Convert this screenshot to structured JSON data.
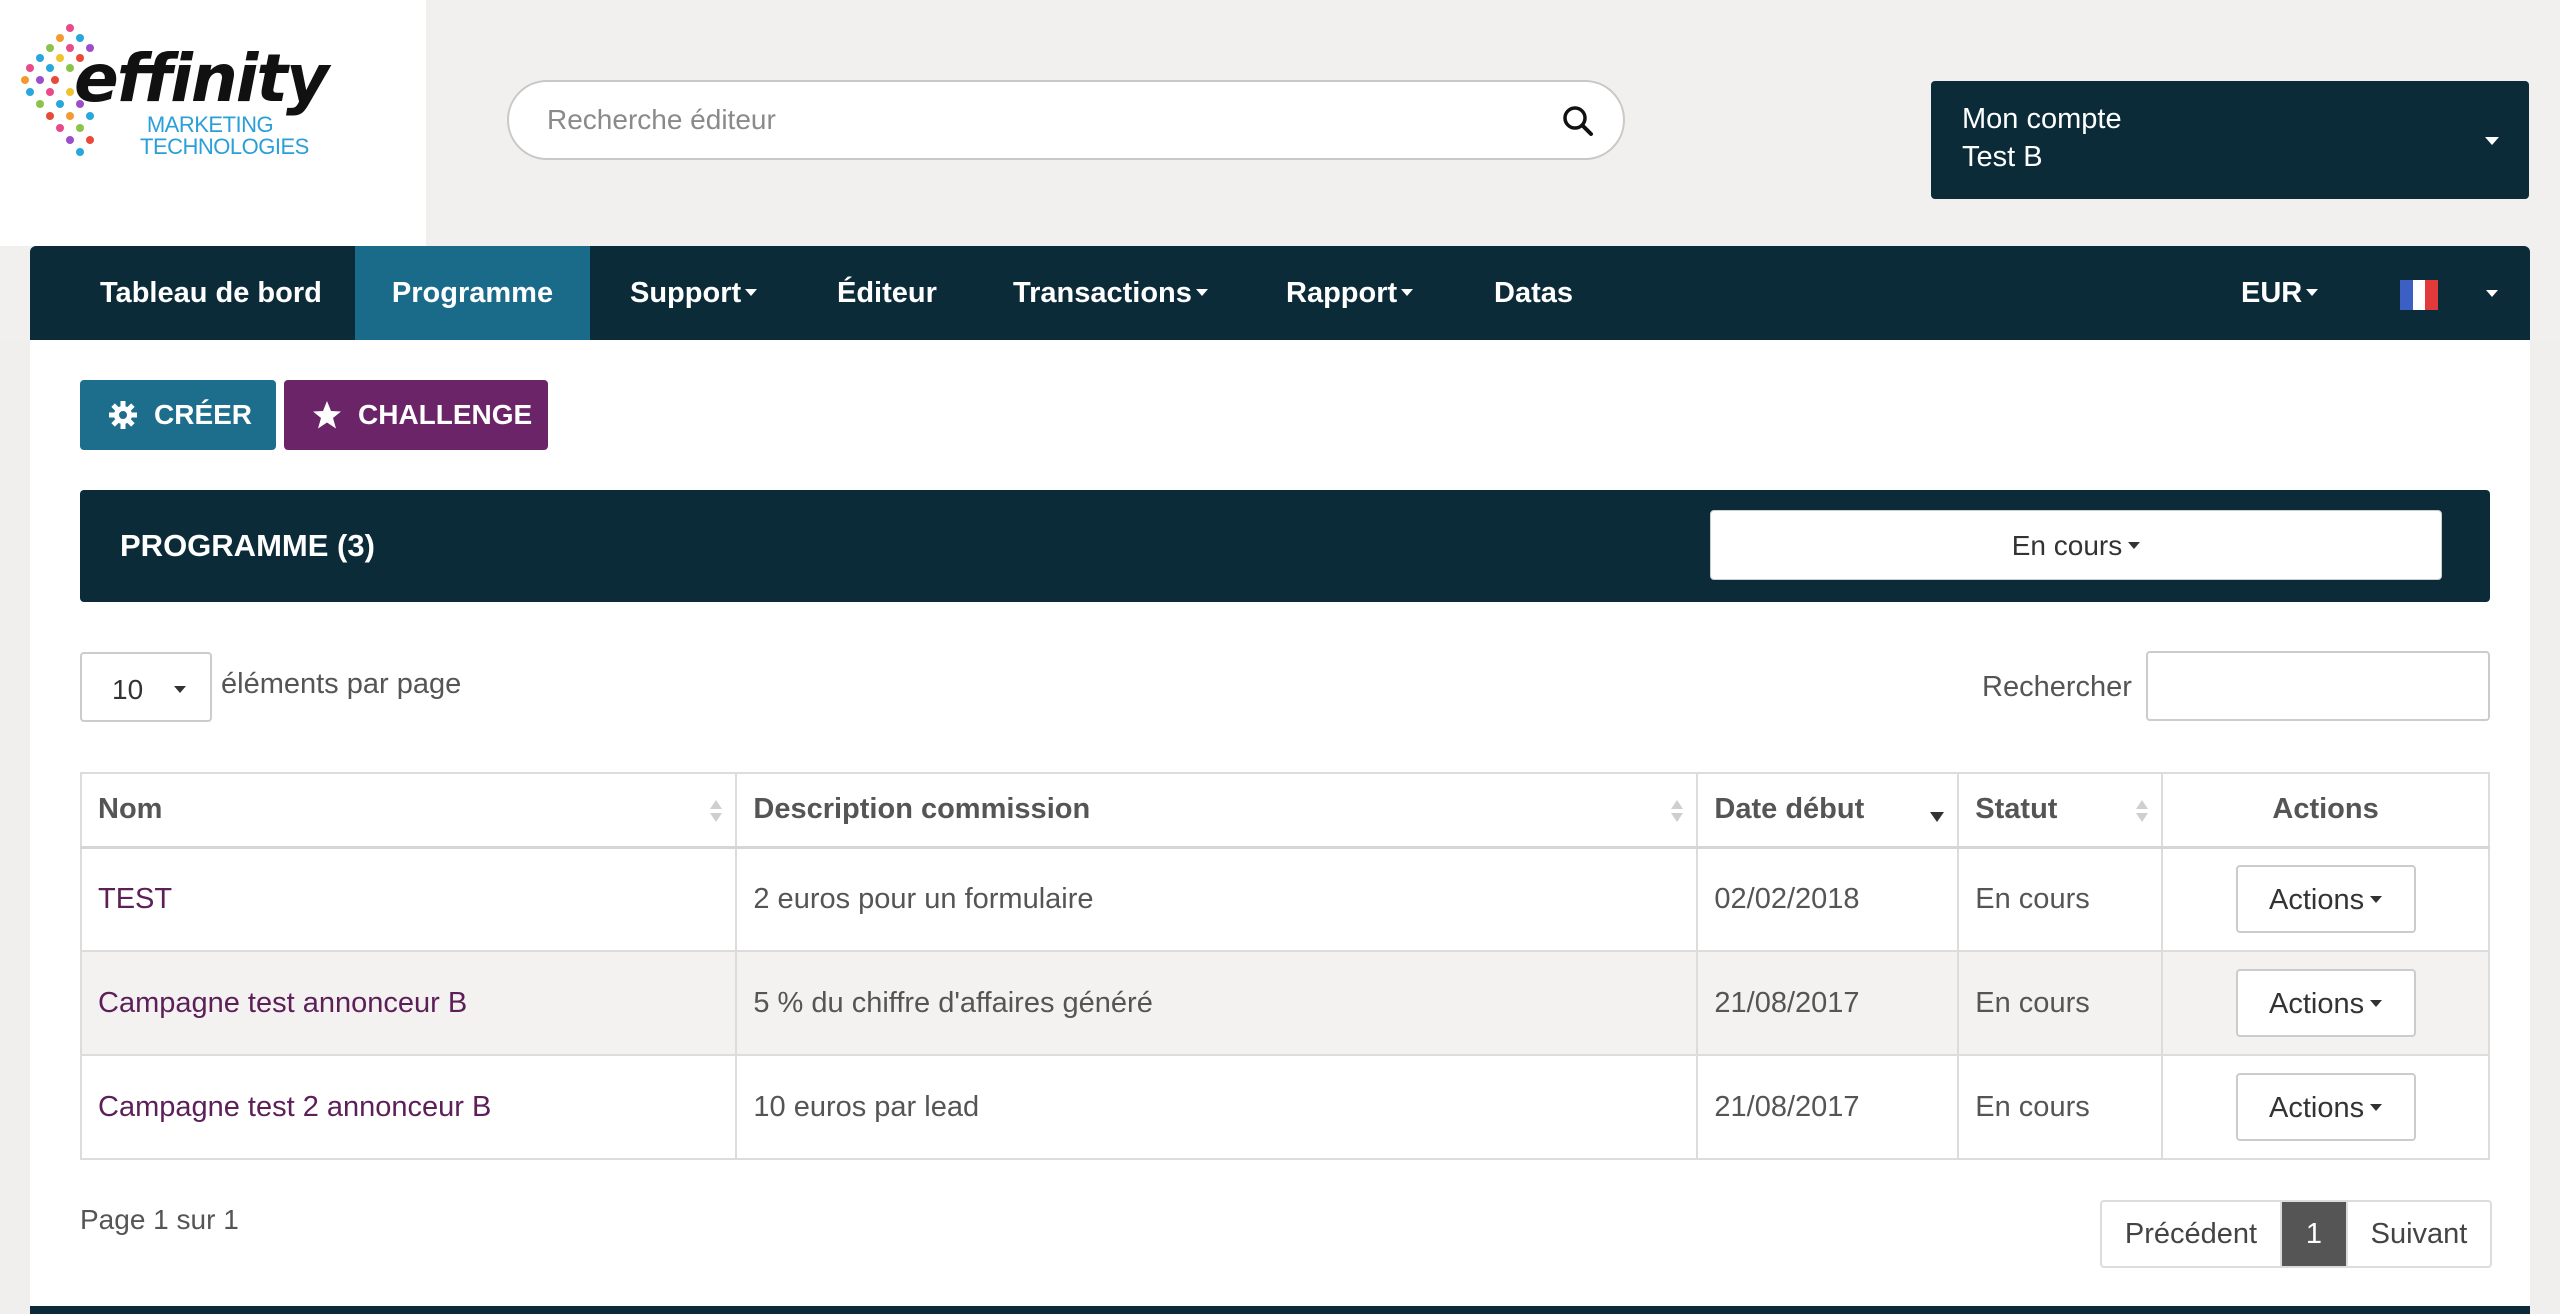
{
  "logo": {
    "word": "effinity",
    "sub_line1": "MARKETING",
    "sub_line2": "TECHNOLOGIES"
  },
  "search": {
    "placeholder": "Recherche éditeur"
  },
  "account": {
    "label": "Mon compte",
    "name": "Test B"
  },
  "nav": {
    "items": [
      {
        "label": "Tableau de bord"
      },
      {
        "label": "Programme"
      },
      {
        "label": "Support"
      },
      {
        "label": "Éditeur"
      },
      {
        "label": "Transactions"
      },
      {
        "label": "Rapport"
      },
      {
        "label": "Datas"
      }
    ],
    "currency": "EUR",
    "flag_colors": [
      "#3b5fc2",
      "#ffffff",
      "#e23a3a"
    ]
  },
  "toolbar": {
    "create_label": "CRÉER",
    "challenge_label": "CHALLENGE"
  },
  "programme": {
    "title": "PROGRAMME (3)",
    "status_filter": "En cours"
  },
  "list_controls": {
    "per_page_value": "10",
    "per_page_label": "éléments par page",
    "search_label": "Rechercher"
  },
  "table": {
    "headers": [
      "Nom",
      "Description commission",
      "Date début",
      "Statut",
      "Actions"
    ],
    "rows": [
      {
        "name": "TEST",
        "description": "2 euros pour un formulaire",
        "date": "02/02/2018",
        "status": "En cours",
        "action": "Actions"
      },
      {
        "name": "Campagne test annonceur B",
        "description": "5 % du chiffre d'affaires généré",
        "date": "21/08/2017",
        "status": "En cours",
        "action": "Actions"
      },
      {
        "name": "Campagne test 2 annonceur B",
        "description": "10 euros par lead",
        "date": "21/08/2017",
        "status": "En cours",
        "action": "Actions"
      }
    ]
  },
  "pagination": {
    "info": "Page 1 sur 1",
    "prev": "Précédent",
    "current": "1",
    "next": "Suivant"
  },
  "colors": {
    "navy": "#0c2b38",
    "nav_active": "#1a6b8a",
    "create_button": "#1d6d8c",
    "challenge_button": "#6b2468",
    "link": "#5c1f58"
  }
}
